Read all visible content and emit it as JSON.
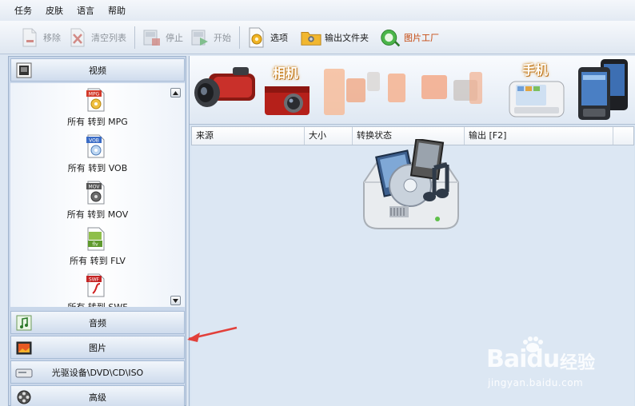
{
  "menu": {
    "items": [
      "任务",
      "皮肤",
      "语言",
      "帮助"
    ]
  },
  "toolbar": {
    "remove": "移除",
    "clear_list": "清空列表",
    "stop": "停止",
    "start": "开始",
    "options": "选项",
    "output_folder": "输出文件夹",
    "picture_factory": "图片工厂"
  },
  "sidebar": {
    "video": "视频",
    "audio": "音频",
    "picture": "图片",
    "rom_device": "光驱设备\\DVD\\CD\\ISO",
    "advanced": "高级",
    "video_items": [
      {
        "label": "所有 转到 MPG",
        "badge": "MPG"
      },
      {
        "label": "所有 转到 VOB",
        "badge": "VOB"
      },
      {
        "label": "所有 转到 MOV",
        "badge": "MOV"
      },
      {
        "label": "所有 转到 FLV",
        "badge": "flv"
      },
      {
        "label": "所有 转到 SWF",
        "badge": "SWF"
      }
    ]
  },
  "banner": {
    "camera": "相机",
    "phone": "手机"
  },
  "table": {
    "columns": [
      "来源",
      "大小",
      "转换状态",
      "输出 [F2]"
    ]
  },
  "watermark": {
    "brand": "Bai",
    "brand2": "du",
    "cn": "经验",
    "url": "jingyan.baidu.com"
  },
  "colors": {
    "accent_blue": "#3f6fb5",
    "panel_bg": "#d6e3f1",
    "arrow_red": "#e2403a"
  }
}
